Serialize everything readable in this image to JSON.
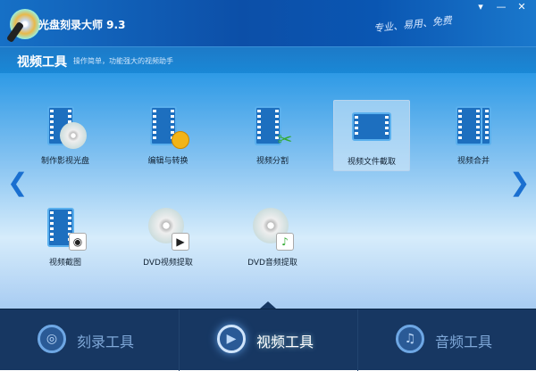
{
  "app": {
    "title": "光盘刻录大师 9.3",
    "tagline": "专业、易用、免费"
  },
  "window": {
    "menu": "▾",
    "minimize": "—",
    "close": "✕"
  },
  "section": {
    "title": "视频工具",
    "description": "操作简单，功能强大的视频助手"
  },
  "items": [
    {
      "label": "制作影视光盘",
      "badge": ""
    },
    {
      "label": "编辑与转换",
      "badge": ""
    },
    {
      "label": "视频分割",
      "badge": "✂"
    },
    {
      "label": "视频文件截取",
      "badge": ""
    },
    {
      "label": "视频合并",
      "badge": ""
    },
    {
      "label": "视频截图",
      "badge": "◉"
    },
    {
      "label": "DVD视频提取",
      "badge": "▶"
    },
    {
      "label": "DVD音频提取",
      "badge": "♪"
    }
  ],
  "nav": {
    "prev": "❮",
    "next": "❯"
  },
  "tabs": [
    {
      "label": "刻录工具",
      "icon": "◎"
    },
    {
      "label": "视频工具",
      "icon": "▶"
    },
    {
      "label": "音频工具",
      "icon": "♫"
    }
  ]
}
